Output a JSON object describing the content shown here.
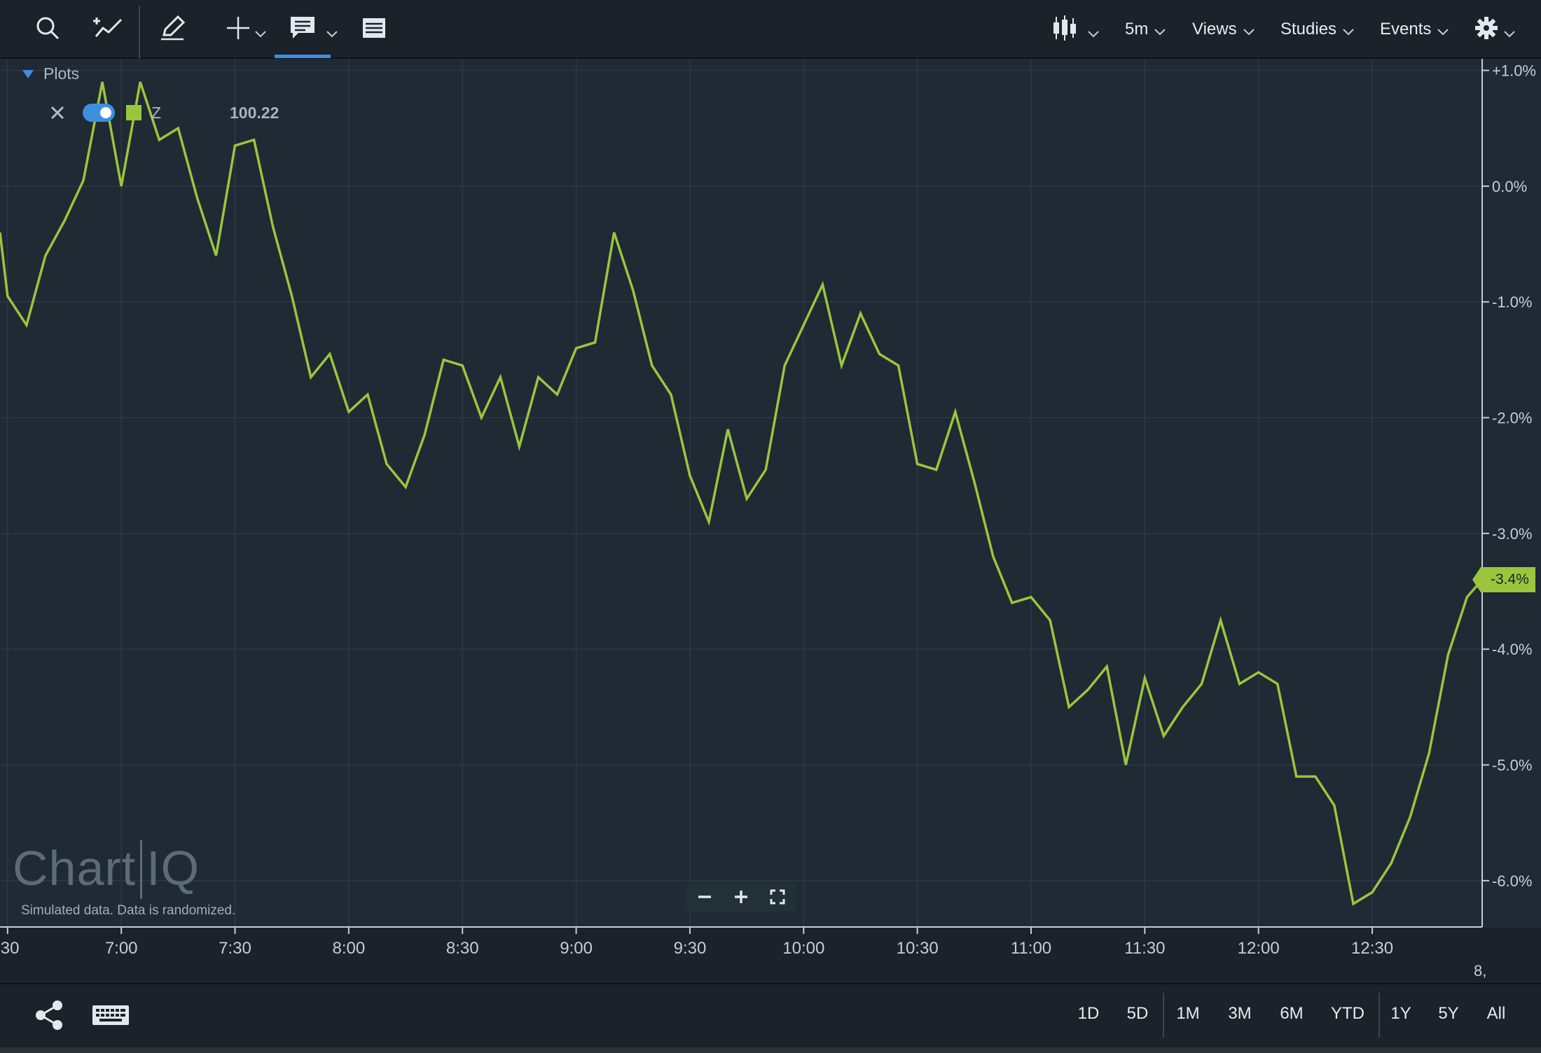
{
  "toolbar": {
    "icons": [
      "search-icon",
      "add-study-line-icon",
      "pencil-icon",
      "crosshair-icon",
      "comment-icon",
      "list-icon",
      "candlestick-icon",
      "gear-icon"
    ],
    "interval": "5m",
    "views": "Views",
    "studies": "Studies",
    "events": "Events"
  },
  "plots": {
    "header": "Plots",
    "symbol": "Z",
    "value": "100.22",
    "swatch_color": "#9bc53d",
    "toggle_on": true
  },
  "watermark": {
    "brand_left": "Chart",
    "brand_right": "IQ",
    "note": "Simulated data.  Data is randomized."
  },
  "price_tag": {
    "label": "-3.4%",
    "color": "#9bc53d"
  },
  "range_buttons": [
    "1D",
    "5D",
    "1M",
    "3M",
    "6M",
    "YTD",
    "1Y",
    "5Y",
    "All"
  ],
  "bottom_icons": [
    "share-icon",
    "keyboard-icon"
  ],
  "chart_data": {
    "type": "line",
    "ylabels": [
      "+1.0%",
      "0.0%",
      "-1.0%",
      "-2.0%",
      "-3.0%",
      "-4.0%",
      "-5.0%",
      "-6.0%"
    ],
    "yticks": [
      1,
      0,
      -1,
      -2,
      -3,
      -4,
      -5,
      -6
    ],
    "ylim": [
      -6.4,
      1.1
    ],
    "xlabels": [
      ":30",
      "7:00",
      "7:30",
      "8:00",
      "8:30",
      "9:00",
      "9:30",
      "10:00",
      "10:30",
      "11:00",
      "11:30",
      "12:00",
      "12:30"
    ],
    "xtick_minutes": [
      390,
      420,
      450,
      480,
      510,
      540,
      570,
      600,
      630,
      660,
      690,
      720,
      750
    ],
    "xlim_minutes": [
      388,
      779
    ],
    "x_edge_label": "8,",
    "line_color": "#9bc53d",
    "grid": true,
    "series": [
      {
        "x": [
          388,
          390,
          395,
          400,
          405,
          410,
          415,
          420,
          425,
          430,
          435,
          440,
          445,
          450,
          455,
          460,
          465,
          470,
          475,
          480,
          485,
          490,
          495,
          500,
          505,
          510,
          515,
          520,
          525,
          530,
          535,
          540,
          545,
          550,
          555,
          560,
          565,
          570,
          575,
          580,
          585,
          590,
          595,
          600,
          605,
          610,
          615,
          620,
          625,
          630,
          635,
          640,
          645,
          650,
          655,
          660,
          665,
          670,
          675,
          680,
          685,
          690,
          695,
          700,
          705,
          710,
          715,
          720,
          725,
          730,
          735,
          740,
          745,
          750,
          755,
          760,
          765,
          770,
          775,
          779
        ],
        "y": [
          -0.4,
          -0.95,
          -1.2,
          -0.6,
          -0.3,
          0.05,
          0.9,
          0.0,
          0.9,
          0.4,
          0.5,
          -0.1,
          -0.6,
          0.35,
          0.4,
          -0.35,
          -0.95,
          -1.65,
          -1.45,
          -1.95,
          -1.8,
          -2.4,
          -2.6,
          -2.15,
          -1.5,
          -1.55,
          -2.0,
          -1.65,
          -2.25,
          -1.65,
          -1.8,
          -1.4,
          -1.35,
          -0.4,
          -0.9,
          -1.55,
          -1.8,
          -2.5,
          -2.9,
          -2.1,
          -2.7,
          -2.45,
          -1.55,
          -1.2,
          -0.85,
          -1.55,
          -1.1,
          -1.45,
          -1.55,
          -2.4,
          -2.45,
          -1.95,
          -2.55,
          -3.2,
          -3.6,
          -3.55,
          -3.75,
          -4.5,
          -4.35,
          -4.15,
          -5.0,
          -4.25,
          -4.75,
          -4.5,
          -4.3,
          -3.75,
          -4.3,
          -4.2,
          -4.3,
          -5.1,
          -5.1,
          -5.35,
          -6.2,
          -6.1,
          -5.85,
          -5.45,
          -4.9,
          -4.05,
          -3.55,
          -3.4
        ]
      }
    ]
  }
}
